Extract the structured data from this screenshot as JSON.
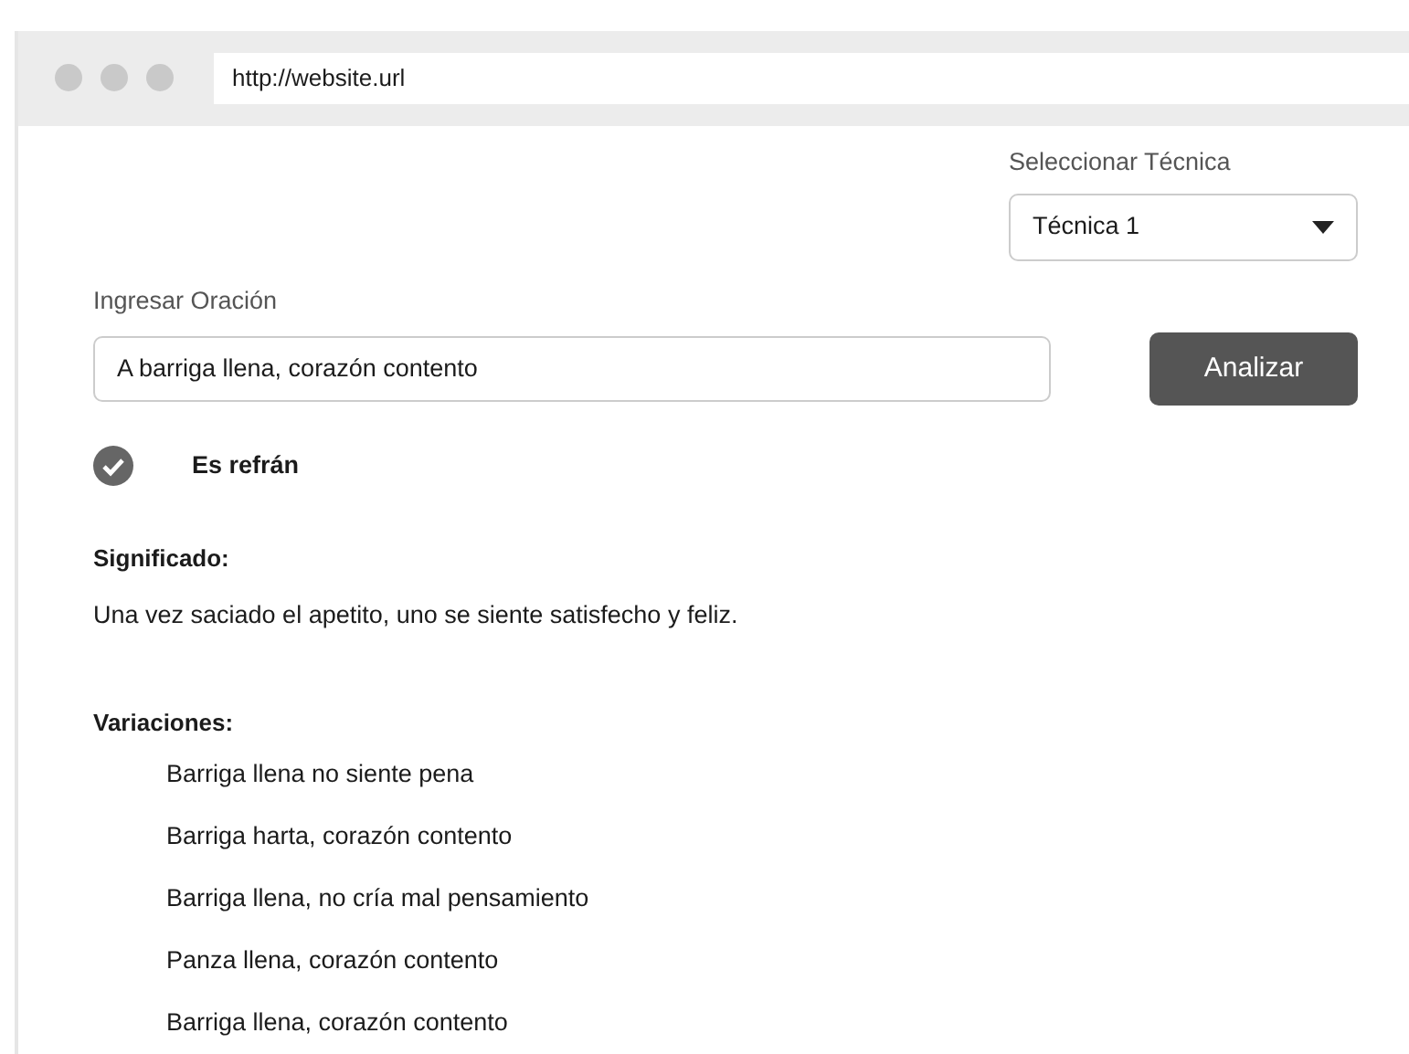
{
  "browser": {
    "url": "http://website.url"
  },
  "technique": {
    "label": "Seleccionar Técnica",
    "value": "Técnica 1"
  },
  "sentence": {
    "label": "Ingresar Oración",
    "value": "A barriga llena, corazón contento"
  },
  "analyze_button": "Analizar",
  "result": {
    "verified": true,
    "label": "Es refrán"
  },
  "meaning": {
    "title": "Significado:",
    "text": "Una vez saciado el apetito, uno se siente satisfecho y feliz."
  },
  "variations": {
    "title": "Variaciones:",
    "items": [
      "Barriga llena no siente pena",
      "Barriga harta, corazón contento",
      "Barriga llena, no cría mal pensamiento",
      "Panza llena, corazón contento",
      "Barriga llena, corazón contento"
    ]
  }
}
